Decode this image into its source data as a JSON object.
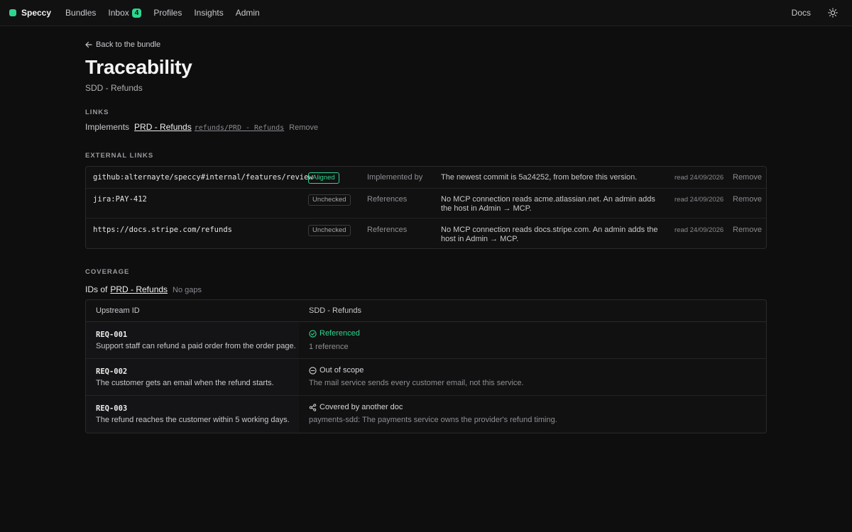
{
  "app": {
    "name": "Speccy",
    "accent": "#2fd58e",
    "nav": [
      {
        "label": "Bundles"
      },
      {
        "label": "Inbox",
        "badge": "4"
      },
      {
        "label": "Profiles"
      },
      {
        "label": "Insights"
      },
      {
        "label": "Admin"
      }
    ],
    "docs_label": "Docs",
    "theme_icon": "sun-icon"
  },
  "page": {
    "back_label": "Back to the bundle",
    "title": "Traceability",
    "subtitle": "SDD - Refunds"
  },
  "links": {
    "section_label": "LINKS",
    "items": [
      {
        "kind": "Implements",
        "doc": "PRD - Refunds",
        "path": "refunds/PRD - Refunds",
        "remove": "Remove"
      }
    ]
  },
  "external_links": {
    "section_label": "EXTERNAL LINKS",
    "rows": [
      {
        "url": "github:alternayte/speccy#internal/features/review",
        "status": "Aligned",
        "relation": "Implemented by",
        "note": "The newest commit is 5a24252, from before this version.",
        "read": "read 24/09/2026",
        "remove": "Remove"
      },
      {
        "url": "jira:PAY-412",
        "status": "Unchecked",
        "relation": "References",
        "note": "No MCP connection reads acme.atlassian.net. An admin adds the host in Admin → MCP.",
        "read": "read 24/09/2026",
        "remove": "Remove"
      },
      {
        "url": "https://docs.stripe.com/refunds",
        "status": "Unchecked",
        "relation": "References",
        "note": "No MCP connection reads docs.stripe.com. An admin adds the host in Admin → MCP.",
        "read": "read 24/09/2026",
        "remove": "Remove"
      }
    ]
  },
  "coverage": {
    "section_label": "COVERAGE",
    "ids_of": "IDs of",
    "doc": "PRD - Refunds",
    "gaps": "No gaps",
    "columns": [
      "Upstream ID",
      "SDD - Refunds"
    ],
    "rows": [
      {
        "id": "REQ-001",
        "text": "Support staff can refund a paid order from the order page.",
        "status": "Referenced",
        "status_icon": "check-circle-icon",
        "detail": "1 reference"
      },
      {
        "id": "REQ-002",
        "text": "The customer gets an email when the refund starts.",
        "status": "Out of scope",
        "status_icon": "minus-circle-icon",
        "detail": "The mail service sends every customer email, not this service."
      },
      {
        "id": "REQ-003",
        "text": "The refund reaches the customer within 5 working days.",
        "status": "Covered by another doc",
        "status_icon": "share-icon",
        "detail": "payments-sdd: The payments service owns the provider's refund timing."
      }
    ]
  }
}
